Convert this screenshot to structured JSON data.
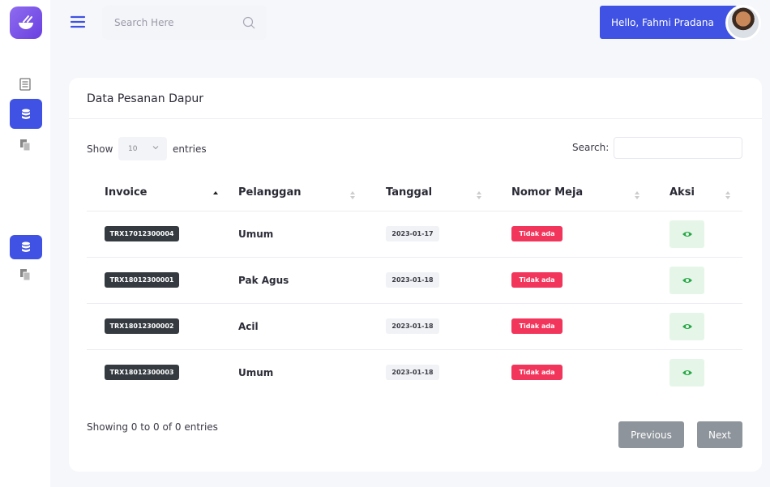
{
  "header": {
    "search_placeholder": "Search Here",
    "greeting": "Hello, Fahmi Pradana"
  },
  "card": {
    "title": "Data Pesanan Dapur",
    "length": {
      "show_label": "Show",
      "value": "10",
      "entries_label": "entries"
    },
    "search_label": "Search:",
    "columns": [
      "Invoice",
      "Pelanggan",
      "Tanggal",
      "Nomor Meja",
      "Aksi"
    ],
    "rows": [
      {
        "invoice": "TRX17012300004",
        "pelanggan": "Umum",
        "tanggal": "2023-01-17",
        "meja": "Tidak ada"
      },
      {
        "invoice": "TRX18012300001",
        "pelanggan": "Pak Agus",
        "tanggal": "2023-01-18",
        "meja": "Tidak ada"
      },
      {
        "invoice": "TRX18012300002",
        "pelanggan": "Acil",
        "tanggal": "2023-01-18",
        "meja": "Tidak ada"
      },
      {
        "invoice": "TRX18012300003",
        "pelanggan": "Umum",
        "tanggal": "2023-01-18",
        "meja": "Tidak ada"
      }
    ],
    "info": "Showing 0 to 0 of 0 entries",
    "prev_label": "Previous",
    "next_label": "Next"
  },
  "colors": {
    "primary": "#3f52e3",
    "danger": "#f2355b",
    "dark": "#343a40",
    "success": "#28a745",
    "success_bg": "#e5f6e9",
    "pager": "#8d949b"
  },
  "icons": [
    "bowl-logo-icon",
    "menu-icon",
    "search-icon",
    "dashboard-icon",
    "database-icon",
    "copy-icon",
    "sort-icon",
    "chevron-down-icon",
    "eye-icon"
  ]
}
